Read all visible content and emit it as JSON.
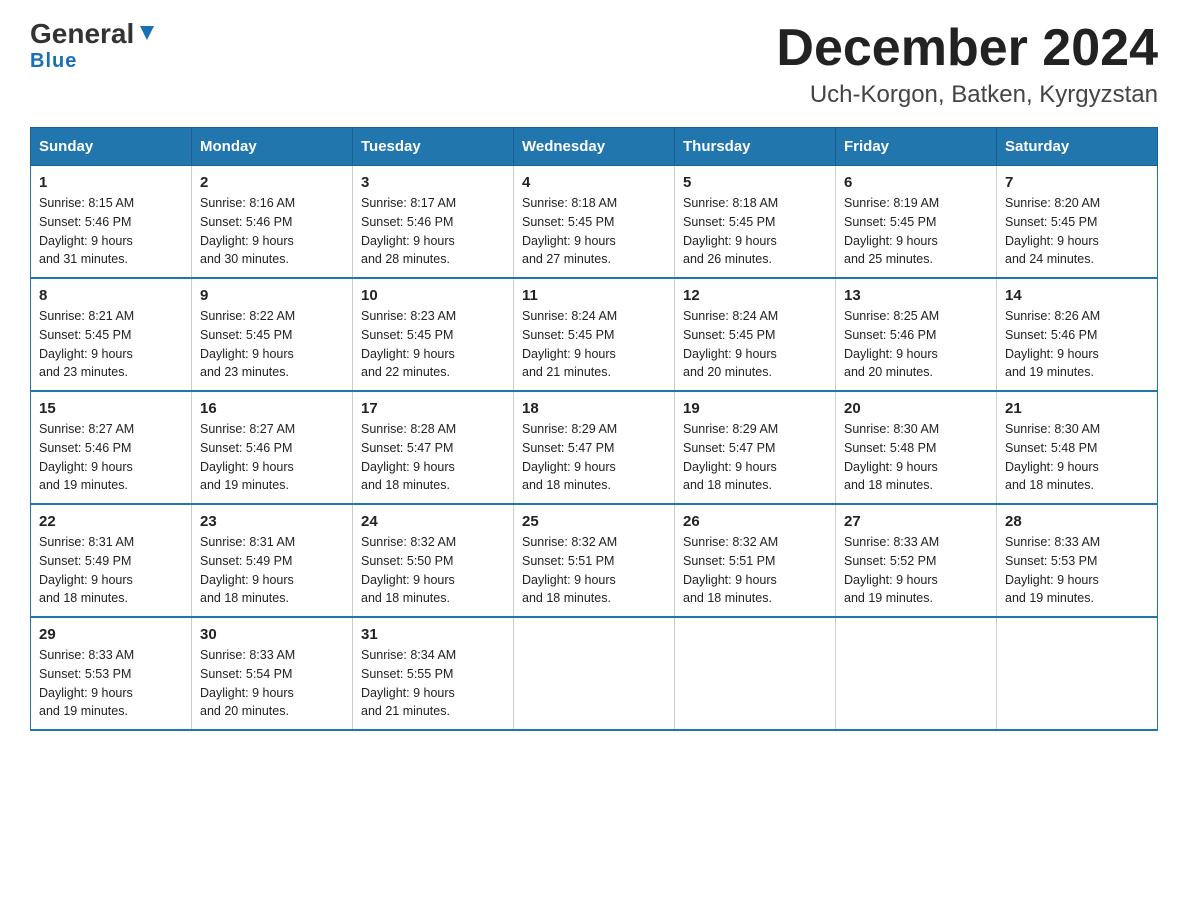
{
  "header": {
    "logo_general": "General",
    "logo_blue": "Blue",
    "title": "December 2024",
    "subtitle": "Uch-Korgon, Batken, Kyrgyzstan"
  },
  "days_of_week": [
    "Sunday",
    "Monday",
    "Tuesday",
    "Wednesday",
    "Thursday",
    "Friday",
    "Saturday"
  ],
  "weeks": [
    [
      {
        "day": "1",
        "info": "Sunrise: 8:15 AM\nSunset: 5:46 PM\nDaylight: 9 hours\nand 31 minutes."
      },
      {
        "day": "2",
        "info": "Sunrise: 8:16 AM\nSunset: 5:46 PM\nDaylight: 9 hours\nand 30 minutes."
      },
      {
        "day": "3",
        "info": "Sunrise: 8:17 AM\nSunset: 5:46 PM\nDaylight: 9 hours\nand 28 minutes."
      },
      {
        "day": "4",
        "info": "Sunrise: 8:18 AM\nSunset: 5:45 PM\nDaylight: 9 hours\nand 27 minutes."
      },
      {
        "day": "5",
        "info": "Sunrise: 8:18 AM\nSunset: 5:45 PM\nDaylight: 9 hours\nand 26 minutes."
      },
      {
        "day": "6",
        "info": "Sunrise: 8:19 AM\nSunset: 5:45 PM\nDaylight: 9 hours\nand 25 minutes."
      },
      {
        "day": "7",
        "info": "Sunrise: 8:20 AM\nSunset: 5:45 PM\nDaylight: 9 hours\nand 24 minutes."
      }
    ],
    [
      {
        "day": "8",
        "info": "Sunrise: 8:21 AM\nSunset: 5:45 PM\nDaylight: 9 hours\nand 23 minutes."
      },
      {
        "day": "9",
        "info": "Sunrise: 8:22 AM\nSunset: 5:45 PM\nDaylight: 9 hours\nand 23 minutes."
      },
      {
        "day": "10",
        "info": "Sunrise: 8:23 AM\nSunset: 5:45 PM\nDaylight: 9 hours\nand 22 minutes."
      },
      {
        "day": "11",
        "info": "Sunrise: 8:24 AM\nSunset: 5:45 PM\nDaylight: 9 hours\nand 21 minutes."
      },
      {
        "day": "12",
        "info": "Sunrise: 8:24 AM\nSunset: 5:45 PM\nDaylight: 9 hours\nand 20 minutes."
      },
      {
        "day": "13",
        "info": "Sunrise: 8:25 AM\nSunset: 5:46 PM\nDaylight: 9 hours\nand 20 minutes."
      },
      {
        "day": "14",
        "info": "Sunrise: 8:26 AM\nSunset: 5:46 PM\nDaylight: 9 hours\nand 19 minutes."
      }
    ],
    [
      {
        "day": "15",
        "info": "Sunrise: 8:27 AM\nSunset: 5:46 PM\nDaylight: 9 hours\nand 19 minutes."
      },
      {
        "day": "16",
        "info": "Sunrise: 8:27 AM\nSunset: 5:46 PM\nDaylight: 9 hours\nand 19 minutes."
      },
      {
        "day": "17",
        "info": "Sunrise: 8:28 AM\nSunset: 5:47 PM\nDaylight: 9 hours\nand 18 minutes."
      },
      {
        "day": "18",
        "info": "Sunrise: 8:29 AM\nSunset: 5:47 PM\nDaylight: 9 hours\nand 18 minutes."
      },
      {
        "day": "19",
        "info": "Sunrise: 8:29 AM\nSunset: 5:47 PM\nDaylight: 9 hours\nand 18 minutes."
      },
      {
        "day": "20",
        "info": "Sunrise: 8:30 AM\nSunset: 5:48 PM\nDaylight: 9 hours\nand 18 minutes."
      },
      {
        "day": "21",
        "info": "Sunrise: 8:30 AM\nSunset: 5:48 PM\nDaylight: 9 hours\nand 18 minutes."
      }
    ],
    [
      {
        "day": "22",
        "info": "Sunrise: 8:31 AM\nSunset: 5:49 PM\nDaylight: 9 hours\nand 18 minutes."
      },
      {
        "day": "23",
        "info": "Sunrise: 8:31 AM\nSunset: 5:49 PM\nDaylight: 9 hours\nand 18 minutes."
      },
      {
        "day": "24",
        "info": "Sunrise: 8:32 AM\nSunset: 5:50 PM\nDaylight: 9 hours\nand 18 minutes."
      },
      {
        "day": "25",
        "info": "Sunrise: 8:32 AM\nSunset: 5:51 PM\nDaylight: 9 hours\nand 18 minutes."
      },
      {
        "day": "26",
        "info": "Sunrise: 8:32 AM\nSunset: 5:51 PM\nDaylight: 9 hours\nand 18 minutes."
      },
      {
        "day": "27",
        "info": "Sunrise: 8:33 AM\nSunset: 5:52 PM\nDaylight: 9 hours\nand 19 minutes."
      },
      {
        "day": "28",
        "info": "Sunrise: 8:33 AM\nSunset: 5:53 PM\nDaylight: 9 hours\nand 19 minutes."
      }
    ],
    [
      {
        "day": "29",
        "info": "Sunrise: 8:33 AM\nSunset: 5:53 PM\nDaylight: 9 hours\nand 19 minutes."
      },
      {
        "day": "30",
        "info": "Sunrise: 8:33 AM\nSunset: 5:54 PM\nDaylight: 9 hours\nand 20 minutes."
      },
      {
        "day": "31",
        "info": "Sunrise: 8:34 AM\nSunset: 5:55 PM\nDaylight: 9 hours\nand 21 minutes."
      },
      {
        "day": "",
        "info": ""
      },
      {
        "day": "",
        "info": ""
      },
      {
        "day": "",
        "info": ""
      },
      {
        "day": "",
        "info": ""
      }
    ]
  ]
}
